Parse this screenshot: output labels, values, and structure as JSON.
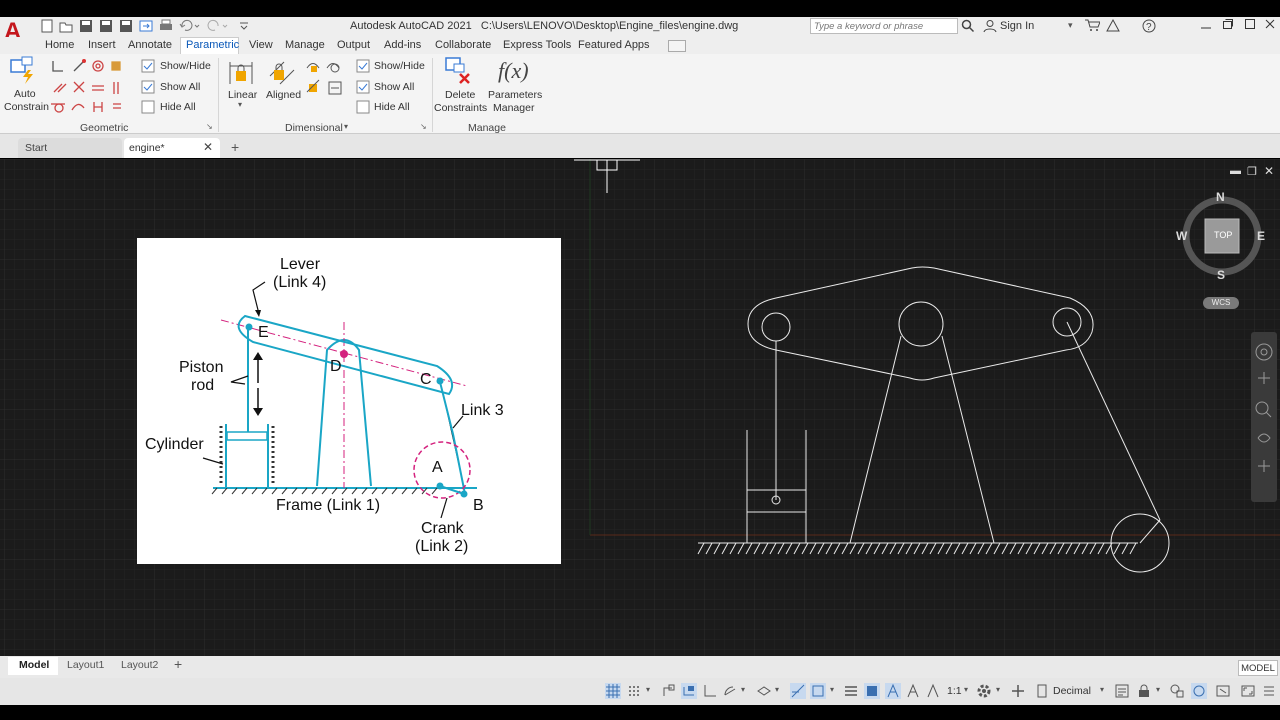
{
  "window": {
    "title": "Autodesk AutoCAD 2021",
    "path": "C:\\Users\\LENOVO\\Desktop\\Engine_files\\engine.dwg",
    "logo_letter": "A",
    "search_placeholder": "Type a keyword or phrase",
    "sign_in": "Sign In"
  },
  "ribbon_tabs": [
    "Home",
    "Insert",
    "Annotate",
    "Parametric",
    "View",
    "Manage",
    "Output",
    "Add-ins",
    "Collaborate",
    "Express Tools",
    "Featured Apps"
  ],
  "active_tab": "Parametric",
  "ribbon": {
    "geometric": {
      "auto_constrain_line1": "Auto",
      "auto_constrain_line2": "Constrain",
      "show_hide": "Show/Hide",
      "show_all": "Show All",
      "hide_all": "Hide All",
      "group_label": "Geometric"
    },
    "dimensional": {
      "linear": "Linear",
      "aligned": "Aligned",
      "show_hide": "Show/Hide",
      "show_all": "Show All",
      "hide_all": "Hide All",
      "group_label": "Dimensional"
    },
    "manage": {
      "delete_line1": "Delete",
      "delete_line2": "Constraints",
      "params_line1": "Parameters",
      "params_line2": "Manager",
      "params_glyph": "f(x)",
      "group_label": "Manage"
    }
  },
  "doc_tabs": [
    {
      "label": "Start"
    },
    {
      "label": "engine*"
    }
  ],
  "viewcube": {
    "north": "N",
    "south": "S",
    "east": "E",
    "west": "W",
    "face": "TOP",
    "wcs": "WCS"
  },
  "reference_image": {
    "lever": "Lever",
    "lever_sub": "(Link 4)",
    "piston": "Piston",
    "piston_sub": "rod",
    "cylinder": "Cylinder",
    "frame": "Frame (Link 1)",
    "crank": "Crank",
    "crank_sub": "(Link 2)",
    "link3": "Link 3",
    "point_e": "E",
    "point_d": "D",
    "point_c": "C",
    "point_a": "A",
    "point_b": "B"
  },
  "layout_tabs": [
    "Model",
    "Layout1",
    "Layout2"
  ],
  "status": {
    "model_badge": "MODEL",
    "scale": "1:1",
    "units": "Decimal"
  },
  "colors": {
    "canvas": "#1b1b1b",
    "sketch_line": "#1aa6c6",
    "centerline": "#d4227e",
    "ribbon_bg": "#f4f4f4"
  }
}
